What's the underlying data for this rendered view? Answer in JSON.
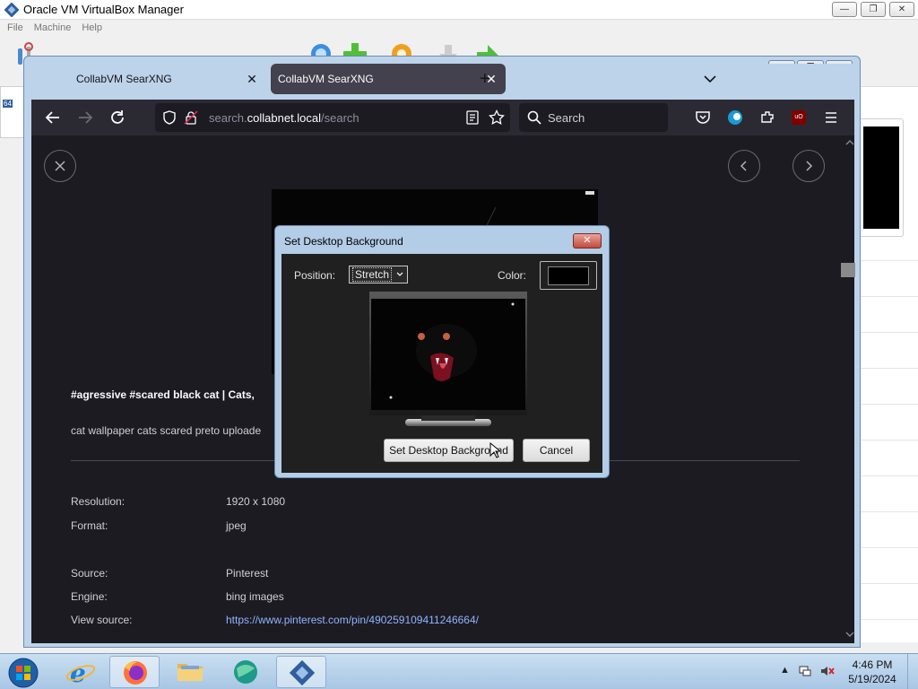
{
  "host": {
    "title": "Oracle VM VirtualBox Manager",
    "menu": [
      "File",
      "Machine",
      "Help"
    ],
    "controls": {
      "minimize": "—",
      "maximize": "❐",
      "close": "✕"
    },
    "list_badge": "64"
  },
  "vm": {
    "controls": {
      "minimize": "—",
      "maximize": "❐",
      "close": "✕"
    }
  },
  "firefox": {
    "tabs": [
      {
        "label": "CollabVM SearXNG",
        "active": false
      },
      {
        "label": "CollabVM SearXNG",
        "active": true
      }
    ],
    "tab_close": "✕",
    "new_tab": "+",
    "tab_list": "⌄",
    "url_prefix": "search.",
    "url_host": "collabnet.local",
    "url_path": "/search",
    "search_placeholder": "Search",
    "ublock_badge": "uO"
  },
  "result": {
    "title": "#agressive #scared black cat | Cats,",
    "description": "cat wallpaper cats scared preto uploade",
    "rows": [
      {
        "label": "Resolution:",
        "value": "1920 x 1080"
      },
      {
        "label": "Format:",
        "value": "jpeg"
      },
      {
        "label": "Source:",
        "value": "Pinterest"
      },
      {
        "label": "Engine:",
        "value": "bing images"
      },
      {
        "label": "View source:",
        "value": "https://www.pinterest.com/pin/490259109411246664/"
      }
    ]
  },
  "dialog": {
    "title": "Set Desktop Background",
    "close": "✕",
    "position_label": "Position:",
    "position_value": "Stretch",
    "color_label": "Color:",
    "color_value": "#000000",
    "ok_label": "Set Desktop Background",
    "cancel_label": "Cancel"
  },
  "taskbar": {
    "time": "4:46 PM",
    "date": "5/19/2024",
    "tray_arrow": "▲"
  },
  "colors": {
    "firefox_bg": "#1c1b22",
    "firefox_toolbar": "#2b2a33",
    "link": "#8fb4ff",
    "dialog_frame": "#b3cde6"
  }
}
